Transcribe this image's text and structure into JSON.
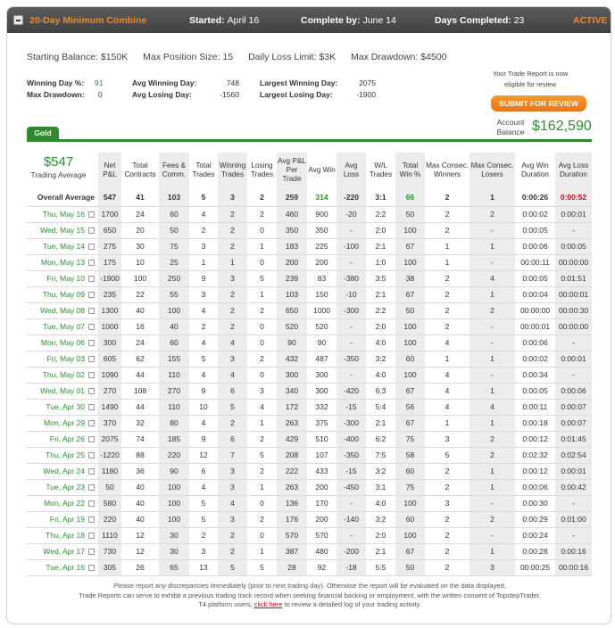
{
  "header": {
    "title": "20-Day Minimum Combine",
    "started_label": "Started:",
    "started": "April 16",
    "complete_label": "Complete by:",
    "complete": "June 14",
    "days_label": "Days Completed:",
    "days": "23",
    "status": "ACTIVE"
  },
  "rules": {
    "starting_balance": "Starting Balance: $150K",
    "max_position": "Max Position Size: 15",
    "daily_loss": "Daily Loss Limit: $3K",
    "max_drawdown": "Max Drawdown: $4500"
  },
  "stats": {
    "winning_day_pct_label": "Winning Day %:",
    "winning_day_pct": "91",
    "max_drawdown_label": "Max Drawdown:",
    "max_drawdown": "0",
    "avg_winning_day_label": "Avg Winning Day:",
    "avg_winning_day": "748",
    "avg_losing_day_label": "Avg Losing Day:",
    "avg_losing_day": "-1560",
    "largest_winning_day_label": "Largest Winning Day:",
    "largest_winning_day": "2075",
    "largest_losing_day_label": "Largest Losing Day:",
    "largest_losing_day": "-1900"
  },
  "report": {
    "note": "Your Trade Report is now eligible for review",
    "submit_label": "SUBMIT FOR REVIEW",
    "account_balance_label": "Account Balance",
    "account_balance": "$162,590",
    "tab_label": "Gold"
  },
  "summary": {
    "value": "$547",
    "label": "Trading Average"
  },
  "columns": [
    "Net P&L",
    "Total Contracts",
    "Fees & Comm.",
    "Total Trades",
    "Winning Trades",
    "Losing Trades",
    "Avg P&L Per Trade",
    "Avg Win",
    "Avg Loss",
    "W/L Trades",
    "Total Win %",
    "Max Consec. Winners",
    "Max Consec. Losers",
    "Avg Win Duration",
    "Avg Loss Duration"
  ],
  "average_row": {
    "label": "Overall Average",
    "cells": [
      "547",
      "41",
      "103",
      "5",
      "3",
      "2",
      "259",
      "314",
      "-220",
      "3:1",
      "66",
      "2",
      "1",
      "0:00:26",
      "0:00:52"
    ]
  },
  "rows": [
    {
      "date": "Thu, May 16",
      "cells": [
        "1700",
        "24",
        "60",
        "4",
        "2",
        "2",
        "460",
        "900",
        "-20",
        "2:2",
        "50",
        "2",
        "2",
        "0:00:02",
        "0:00:01"
      ]
    },
    {
      "date": "Wed, May 15",
      "cells": [
        "650",
        "20",
        "50",
        "2",
        "2",
        "0",
        "350",
        "350",
        "-",
        "2:0",
        "100",
        "2",
        "-",
        "0:00:05",
        "-"
      ]
    },
    {
      "date": "Tue, May 14",
      "cells": [
        "275",
        "30",
        "75",
        "3",
        "2",
        "1",
        "183",
        "225",
        "-100",
        "2:1",
        "67",
        "1",
        "1",
        "0:00:06",
        "0:00:05"
      ]
    },
    {
      "date": "Mon, May 13",
      "cells": [
        "175",
        "10",
        "25",
        "1",
        "1",
        "0",
        "200",
        "200",
        "-",
        "1:0",
        "100",
        "1",
        "-",
        "00:00:11",
        "00:00:00"
      ]
    },
    {
      "date": "Fri, May 10",
      "cells": [
        "-1900",
        "100",
        "250",
        "9",
        "3",
        "5",
        "239",
        "83",
        "-380",
        "3:5",
        "38",
        "2",
        "4",
        "0:00:05",
        "0:01:51"
      ]
    },
    {
      "date": "Thu, May 09",
      "cells": [
        "235",
        "22",
        "55",
        "3",
        "2",
        "1",
        "103",
        "150",
        "-10",
        "2:1",
        "67",
        "2",
        "1",
        "0:00:04",
        "00:00:01"
      ]
    },
    {
      "date": "Wed, May 08",
      "cells": [
        "1300",
        "40",
        "100",
        "4",
        "2",
        "2",
        "650",
        "1000",
        "-300",
        "2:2",
        "50",
        "2",
        "2",
        "00:00:00",
        "00:00:30"
      ]
    },
    {
      "date": "Tue, May 07",
      "cells": [
        "1000",
        "16",
        "40",
        "2",
        "2",
        "0",
        "520",
        "520",
        "-",
        "2:0",
        "100",
        "2",
        "-",
        "00:00:01",
        "00:00:00"
      ]
    },
    {
      "date": "Mon, May 06",
      "cells": [
        "300",
        "24",
        "60",
        "4",
        "4",
        "0",
        "90",
        "90",
        "-",
        "4:0",
        "100",
        "4",
        "-",
        "0:00:06",
        "-"
      ]
    },
    {
      "date": "Fri, May 03",
      "cells": [
        "605",
        "62",
        "155",
        "5",
        "3",
        "2",
        "432",
        "487",
        "-350",
        "3:2",
        "60",
        "1",
        "1",
        "0:00:02",
        "0:00:01"
      ]
    },
    {
      "date": "Thu, May 02",
      "cells": [
        "1090",
        "44",
        "110",
        "4",
        "4",
        "0",
        "300",
        "300",
        "-",
        "4:0",
        "100",
        "4",
        "-",
        "0:00:34",
        "-"
      ]
    },
    {
      "date": "Wed, May 01",
      "cells": [
        "270",
        "108",
        "270",
        "9",
        "6",
        "3",
        "340",
        "300",
        "-420",
        "6:3",
        "67",
        "4",
        "1",
        "0:00:05",
        "0:00:06"
      ]
    },
    {
      "date": "Tue, Apr 30",
      "cells": [
        "1490",
        "44",
        "110",
        "10",
        "5",
        "4",
        "172",
        "332",
        "-15",
        "5:4",
        "56",
        "4",
        "4",
        "0:00:11",
        "0:00:07"
      ]
    },
    {
      "date": "Mon, Apr 29",
      "cells": [
        "370",
        "32",
        "80",
        "4",
        "2",
        "1",
        "263",
        "375",
        "-300",
        "2:1",
        "67",
        "1",
        "1",
        "0:00:18",
        "0:00:07"
      ]
    },
    {
      "date": "Fri, Apr 26",
      "cells": [
        "2075",
        "74",
        "185",
        "9",
        "6",
        "2",
        "429",
        "510",
        "-400",
        "6:2",
        "75",
        "3",
        "2",
        "0:00:12",
        "0:01:45"
      ]
    },
    {
      "date": "Thu, Apr 25",
      "cells": [
        "-1220",
        "88",
        "220",
        "12",
        "7",
        "5",
        "208",
        "107",
        "-350",
        "7:5",
        "58",
        "5",
        "2",
        "0:02:32",
        "0:02:54"
      ]
    },
    {
      "date": "Wed, Apr 24",
      "cells": [
        "1180",
        "36",
        "90",
        "6",
        "3",
        "2",
        "222",
        "433",
        "-15",
        "3:2",
        "60",
        "2",
        "1",
        "0:00:12",
        "0:00:01"
      ]
    },
    {
      "date": "Tue, Apr 23",
      "cells": [
        "50",
        "40",
        "100",
        "4",
        "3",
        "1",
        "263",
        "200",
        "-450",
        "3:1",
        "75",
        "2",
        "1",
        "0:00:06",
        "0:00:42"
      ]
    },
    {
      "date": "Mon, Apr 22",
      "cells": [
        "580",
        "40",
        "100",
        "5",
        "4",
        "0",
        "136",
        "170",
        "-",
        "4:0",
        "100",
        "3",
        "-",
        "0:00:30",
        "-"
      ]
    },
    {
      "date": "Fri, Apr 19",
      "cells": [
        "220",
        "40",
        "100",
        "5",
        "3",
        "2",
        "176",
        "200",
        "-140",
        "3:2",
        "60",
        "2",
        "2",
        "0:00:29",
        "0:01:00"
      ]
    },
    {
      "date": "Thu, Apr 18",
      "cells": [
        "1110",
        "12",
        "30",
        "2",
        "2",
        "0",
        "570",
        "570",
        "-",
        "2:0",
        "100",
        "2",
        "-",
        "0:00:24",
        "-"
      ]
    },
    {
      "date": "Wed, Apr 17",
      "cells": [
        "730",
        "12",
        "30",
        "3",
        "2",
        "1",
        "387",
        "480",
        "-200",
        "2:1",
        "67",
        "2",
        "1",
        "0:00:28",
        "0:00:16"
      ]
    },
    {
      "date": "Tue, Apr 16",
      "cells": [
        "305",
        "26",
        "65",
        "13",
        "5",
        "5",
        "28",
        "92",
        "-18",
        "5:5",
        "50",
        "2",
        "3",
        "00:00:25",
        "00:00:16"
      ]
    }
  ],
  "footer": {
    "line1": "Please report any discrepancies immediately (prior to next trading day). Otherwise the report will be evaluated on the data displayed.",
    "line2": "Trade Reports can serve to exhibit a previous trading track record when seeking financial backing or employment, with the written consent of TopstepTrader.",
    "line3_pre": "T4 platform users,",
    "line3_link": "click here",
    "line3_post": "to review a detailed log of your trading activity."
  }
}
